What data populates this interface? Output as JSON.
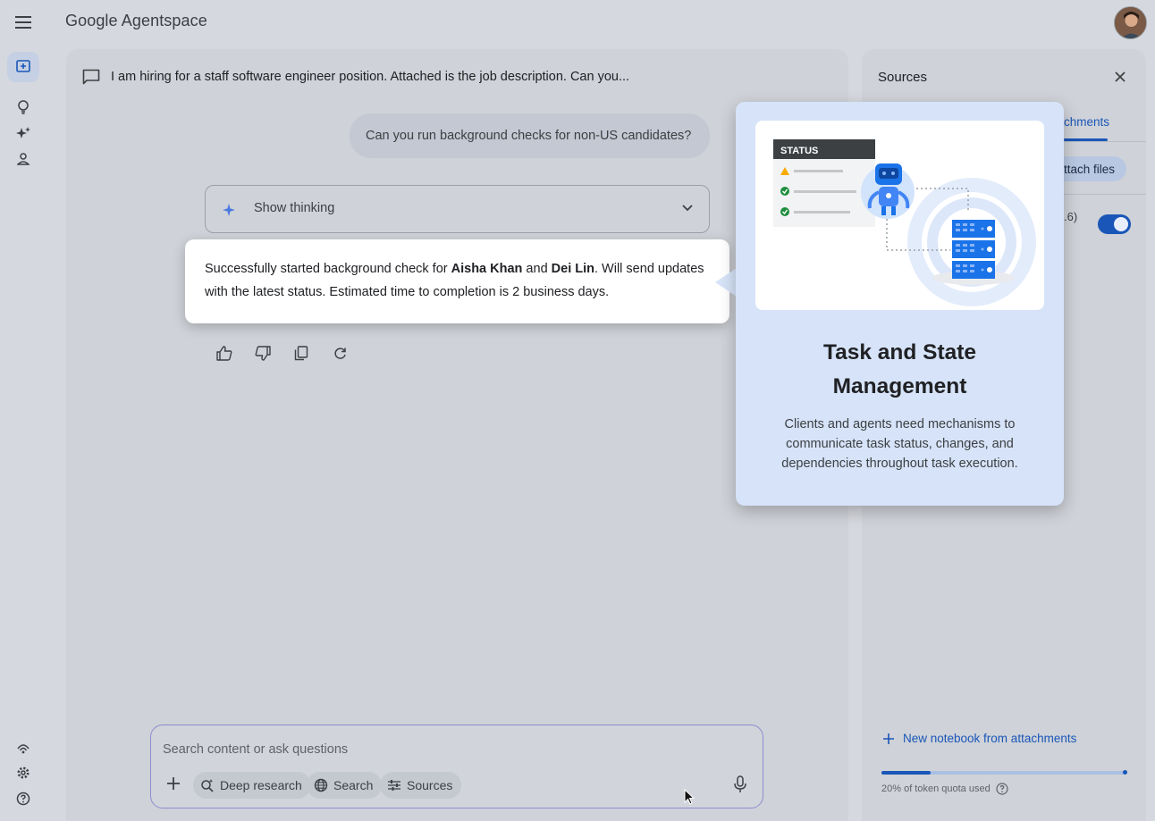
{
  "app": {
    "title": "Google Agentspace"
  },
  "rail": {
    "icons": [
      "new-chat-icon",
      "lightbulb-icon",
      "sparkle-icon",
      "person-icon",
      "broadcast-icon",
      "gear-icon",
      "help-icon"
    ]
  },
  "chat": {
    "title": "I am hiring for a staff software engineer position. Attached is the job description. Can you...",
    "user_message": "Can you run background checks for non-US candidates?",
    "thinking_label": "Show thinking",
    "answer": {
      "prefix": "Successfully started background check for ",
      "name1": "Aisha Khan",
      "mid": " and ",
      "name2": "Dei Lin",
      "suffix": ". Will send updates with the latest status. Estimated time to completion is 2 business days."
    }
  },
  "input": {
    "placeholder": "Search content or ask questions",
    "chips": {
      "deep_research": "Deep research",
      "search": "Search",
      "sources": "Sources"
    }
  },
  "sources": {
    "title": "Sources",
    "tab_partial": "chments",
    "attach_partial": "ttach files",
    "count_partial": ".6)",
    "new_notebook": "New notebook from attachments",
    "quota_text": "20% of token quota used",
    "quota_fraction": 0.2,
    "toggle_on": true
  },
  "info_card": {
    "status_label": "STATUS",
    "title": "Task and State Management",
    "description": "Clients and agents need mechanisms to communicate task status, changes, and dependencies throughout task execution."
  },
  "colors": {
    "accent": "#1a56b8",
    "card_bg": "#d6e3f8",
    "page_bg": "#d5d8de"
  }
}
